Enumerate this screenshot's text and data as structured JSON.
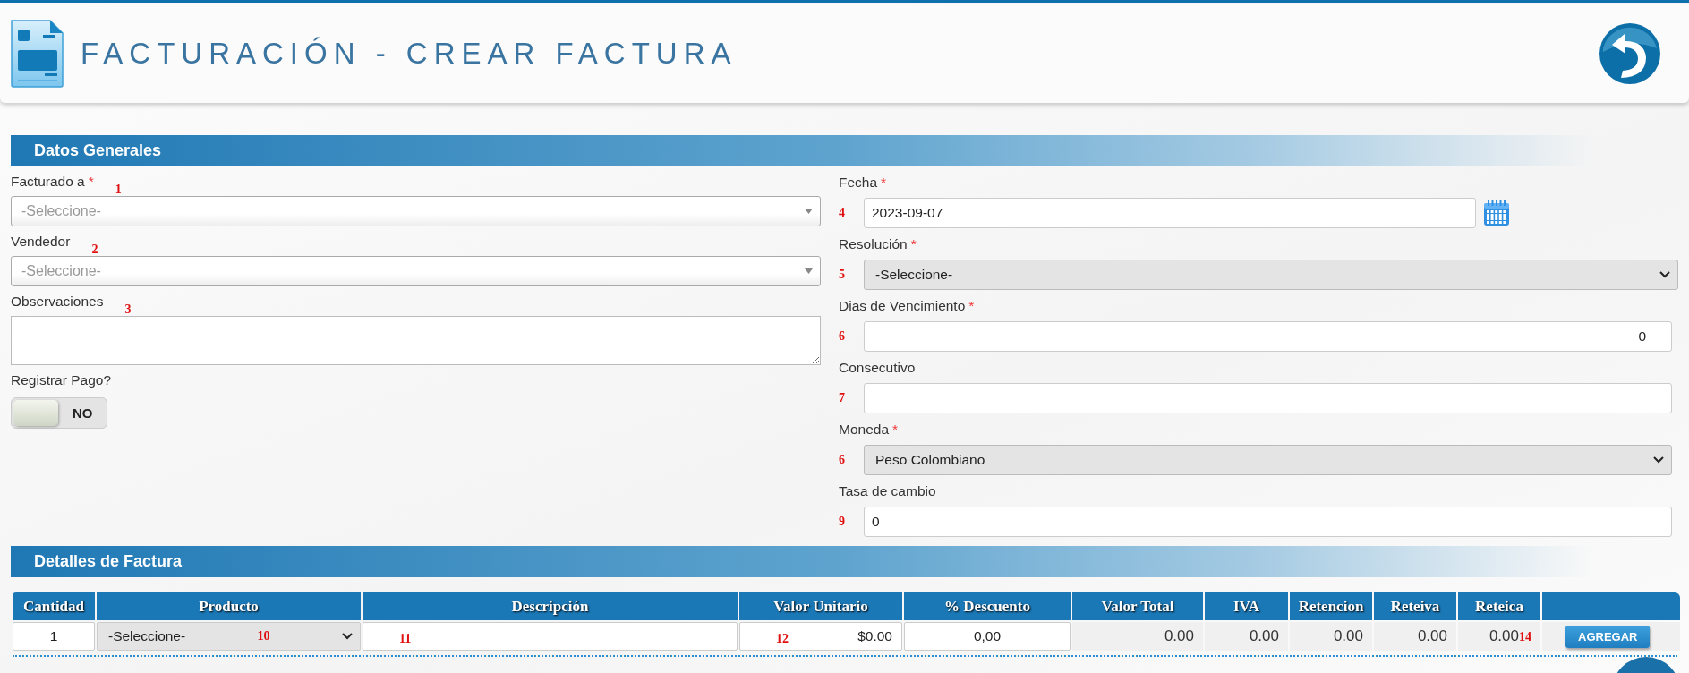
{
  "header": {
    "title": "FACTURACIÓN - CREAR FACTURA"
  },
  "general": {
    "title": "Datos Generales",
    "left_fields": [
      {
        "kind": "combo",
        "label": "Facturado a",
        "required_mark": "*",
        "placeholder": "-Seleccione-",
        "marker": "1"
      },
      {
        "kind": "combo",
        "label": "Vendedor",
        "placeholder": "-Seleccione-",
        "marker": "2"
      },
      {
        "kind": "textarea",
        "label": "Observaciones",
        "marker": "3"
      }
    ],
    "payment_toggle": {
      "label": "Registrar Pago?",
      "state_label": "NO",
      "on": false
    },
    "right_fields": [
      {
        "kind": "date",
        "label": "Fecha",
        "required_mark": "*",
        "value": "2023-09-07",
        "marker": "4"
      },
      {
        "kind": "select",
        "label": "Resolución",
        "required_mark": "*",
        "value": "-Seleccione-",
        "marker": "5"
      },
      {
        "kind": "number",
        "label": "Dias de Vencimiento",
        "required_mark": "*",
        "value": "0",
        "marker": "6"
      },
      {
        "kind": "text",
        "label": "Consecutivo",
        "marker": "7"
      },
      {
        "kind": "select",
        "label": "Moneda",
        "required_mark": "*",
        "value": "Peso Colombiano",
        "marker": "6"
      },
      {
        "kind": "text",
        "label": "Tasa de cambio",
        "value": "0",
        "marker": "9"
      }
    ]
  },
  "details": {
    "title": "Detalles de Factura",
    "columns": [
      "Cantidad",
      "Producto",
      "Descripción",
      "Valor Unitario",
      "% Descuento",
      "Valor Total",
      "IVA",
      "Retencion",
      "Reteiva",
      "Reteica"
    ],
    "rows": [
      {
        "cells": [
          {
            "kind": "input",
            "value": "1"
          },
          {
            "kind": "select",
            "value": "-Seleccione-",
            "marker": "10"
          },
          {
            "kind": "input",
            "marker": "11"
          },
          {
            "kind": "input",
            "value": "$0.00",
            "marker": "12"
          },
          {
            "kind": "input",
            "value": "0,00"
          },
          {
            "kind": "readonly",
            "value": "0.00"
          },
          {
            "kind": "readonly",
            "value": "0.00"
          },
          {
            "kind": "readonly",
            "value": "0.00"
          },
          {
            "kind": "readonly",
            "value": "0.00"
          },
          {
            "kind": "readonly",
            "value": "0.00",
            "marker": "14"
          },
          {
            "kind": "button",
            "value": "AGREGAR"
          }
        ]
      }
    ]
  }
}
